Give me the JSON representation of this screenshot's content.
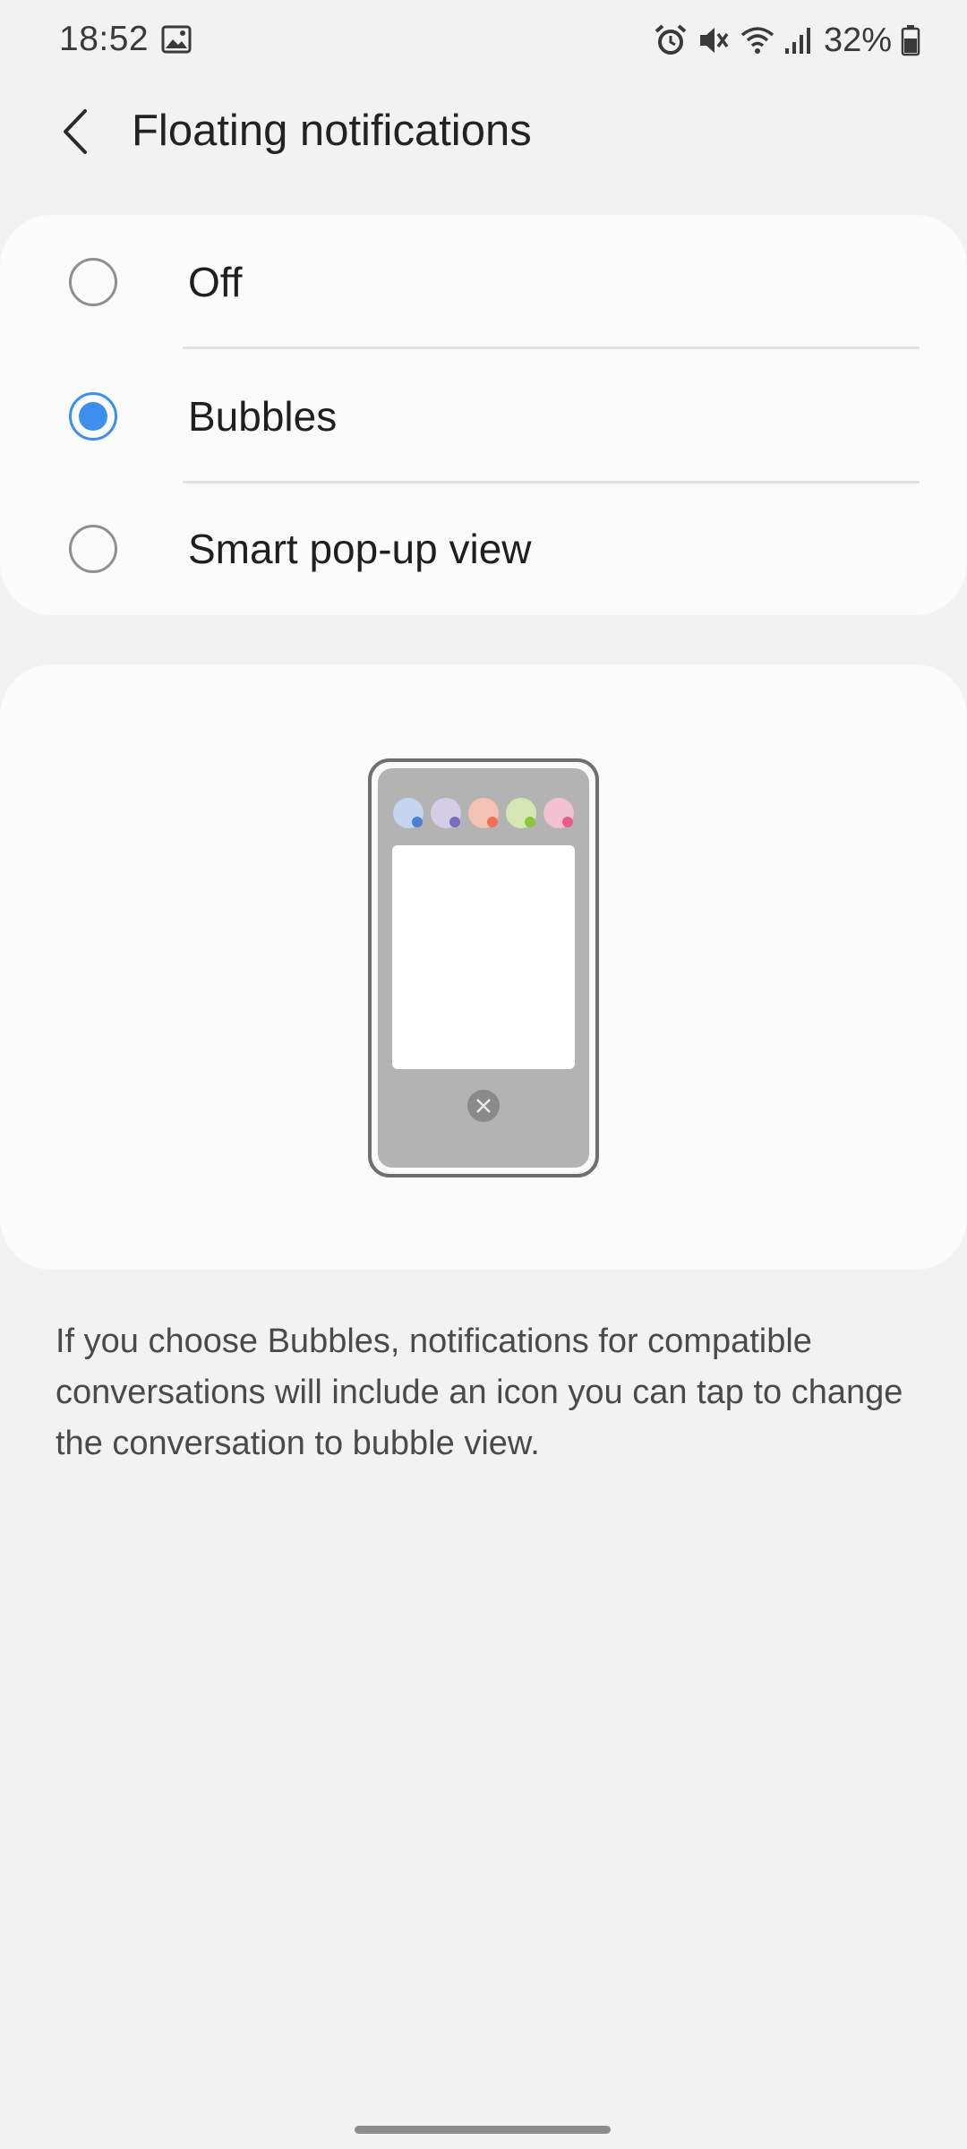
{
  "status_bar": {
    "time": "18:52",
    "battery": "32%",
    "icons": [
      "gallery-icon",
      "alarm-icon",
      "mute-icon",
      "wifi-icon",
      "signal-icon",
      "battery-icon"
    ]
  },
  "header": {
    "title": "Floating notifications",
    "back_icon": "chevron-left-icon"
  },
  "options": [
    {
      "label": "Off",
      "selected": false
    },
    {
      "label": "Bubbles",
      "selected": true
    },
    {
      "label": "Smart pop-up view",
      "selected": false
    }
  ],
  "illustration": {
    "bubble_colors": [
      "#c3d5ef",
      "#d3cde6",
      "#f3c2b4",
      "#d5e7b2",
      "#f2c0d0"
    ],
    "bubble_dot_colors": [
      "#4a7fd4",
      "#7a6cc0",
      "#f07052",
      "#8cc43e",
      "#e95a8a"
    ]
  },
  "description": "If you choose Bubbles, notifications for compatible conversations will include an icon you can tap to change the conversation to bubble view.",
  "colors": {
    "accent": "#3e8ef0",
    "background": "#f2f2f2",
    "card": "#fbfbfb"
  }
}
